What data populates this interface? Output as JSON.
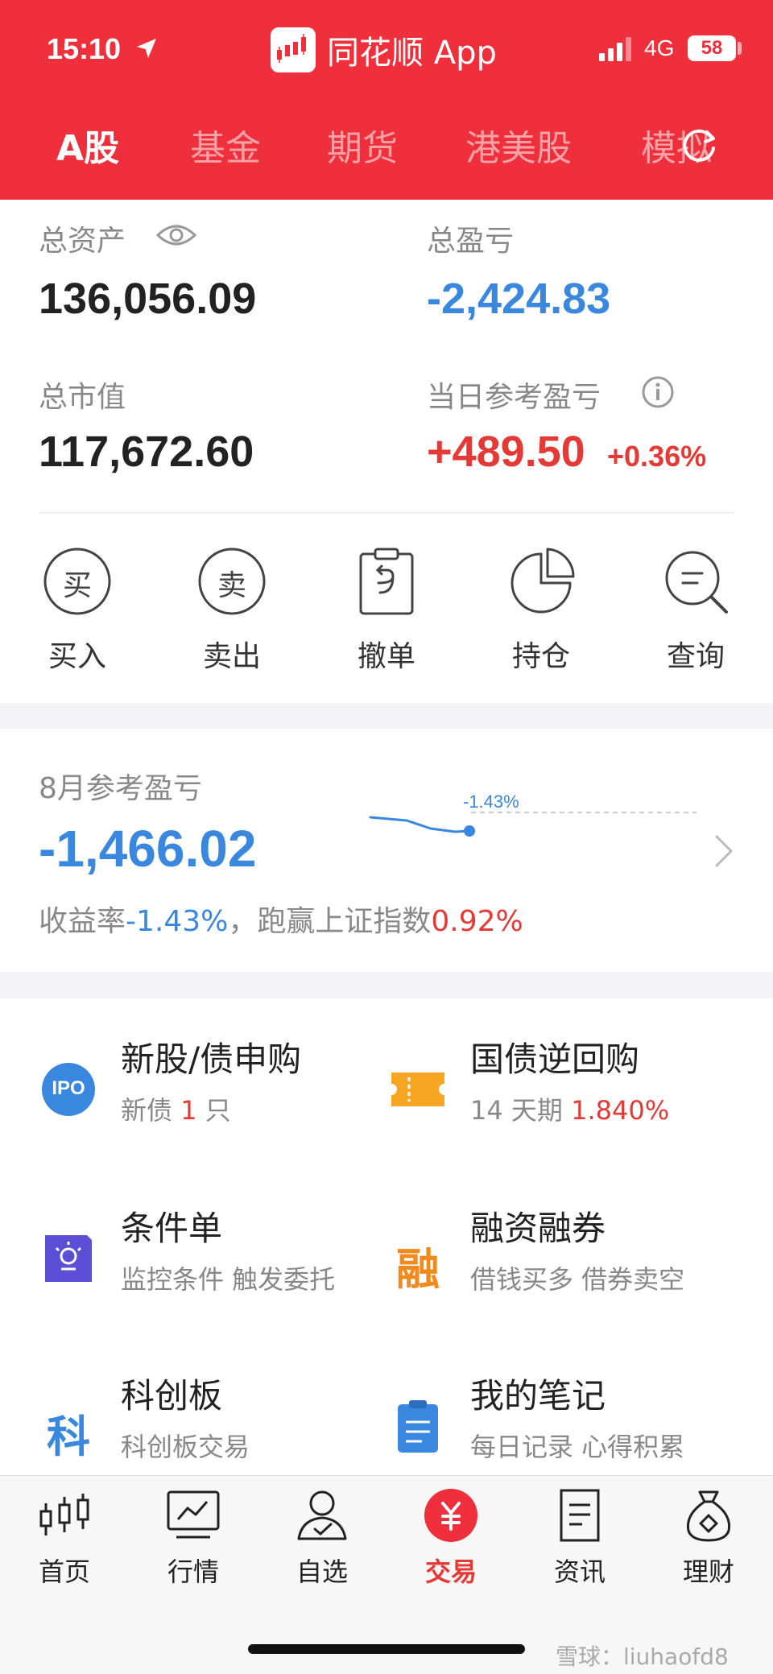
{
  "status_bar": {
    "time": "15:10",
    "app_name": "同花顺 App",
    "network": "4G",
    "battery": "58"
  },
  "tabs": [
    {
      "label": "A股",
      "active": true
    },
    {
      "label": "基金",
      "active": false
    },
    {
      "label": "期货",
      "active": false
    },
    {
      "label": "港美股",
      "active": false
    },
    {
      "label": "模拟",
      "active": false
    }
  ],
  "assets": {
    "total_assets_label": "总资产",
    "total_assets_value": "136,056.09",
    "total_pnl_label": "总盈亏",
    "total_pnl_value": "-2,424.83",
    "market_value_label": "总市值",
    "market_value_value": "117,672.60",
    "daily_pnl_label": "当日参考盈亏",
    "daily_pnl_value": "+489.50",
    "daily_pnl_pct": "+0.36%"
  },
  "actions": [
    {
      "label": "买入",
      "icon": "buy-icon",
      "glyph": "买"
    },
    {
      "label": "卖出",
      "icon": "sell-icon",
      "glyph": "卖"
    },
    {
      "label": "撤单",
      "icon": "cancel-order-icon"
    },
    {
      "label": "持仓",
      "icon": "position-icon"
    },
    {
      "label": "查询",
      "icon": "query-icon"
    }
  ],
  "monthly": {
    "title": "8月参考盈亏",
    "value": "-1,466.02",
    "yield_label": "收益率",
    "yield_value": "-1.43%",
    "compare_label": "，跑赢上证指数",
    "compare_value": "0.92%",
    "spark_label": "-1.43%"
  },
  "features": [
    {
      "title": "新股/债申购",
      "sub_prefix": "新债 ",
      "sub_highlight": "1",
      "sub_suffix": " 只",
      "icon": "ipo-icon",
      "icon_text": "IPO"
    },
    {
      "title": "国债逆回购",
      "sub_prefix": "14 天期 ",
      "sub_highlight": "1.840%",
      "sub_suffix": "",
      "icon": "ticket-icon"
    },
    {
      "title": "条件单",
      "sub_prefix": "监控条件 触发委托",
      "sub_highlight": "",
      "sub_suffix": "",
      "icon": "condition-order-icon"
    },
    {
      "title": "融资融券",
      "sub_prefix": "借钱买多 借券卖空",
      "sub_highlight": "",
      "sub_suffix": "",
      "icon": "margin-icon",
      "icon_text": "融"
    },
    {
      "title": "科创板",
      "sub_prefix": "科创板交易",
      "sub_highlight": "",
      "sub_suffix": "",
      "icon": "star-market-icon",
      "icon_text": "科"
    },
    {
      "title": "我的笔记",
      "sub_prefix": "每日记录 心得积累",
      "sub_highlight": "",
      "sub_suffix": "",
      "icon": "notes-icon"
    }
  ],
  "bottom_nav": [
    {
      "label": "首页",
      "icon": "home-icon",
      "active": false
    },
    {
      "label": "行情",
      "icon": "market-icon",
      "active": false
    },
    {
      "label": "自选",
      "icon": "watchlist-icon",
      "active": false
    },
    {
      "label": "交易",
      "icon": "trade-icon",
      "active": true
    },
    {
      "label": "资讯",
      "icon": "news-icon",
      "active": false
    },
    {
      "label": "理财",
      "icon": "wealth-icon",
      "active": false
    }
  ],
  "watermark": "雪球：liuhaofd8",
  "colors": {
    "brand_red": "#ef2f3b",
    "gain_red": "#e53935",
    "loss_blue": "#3a87e0"
  }
}
